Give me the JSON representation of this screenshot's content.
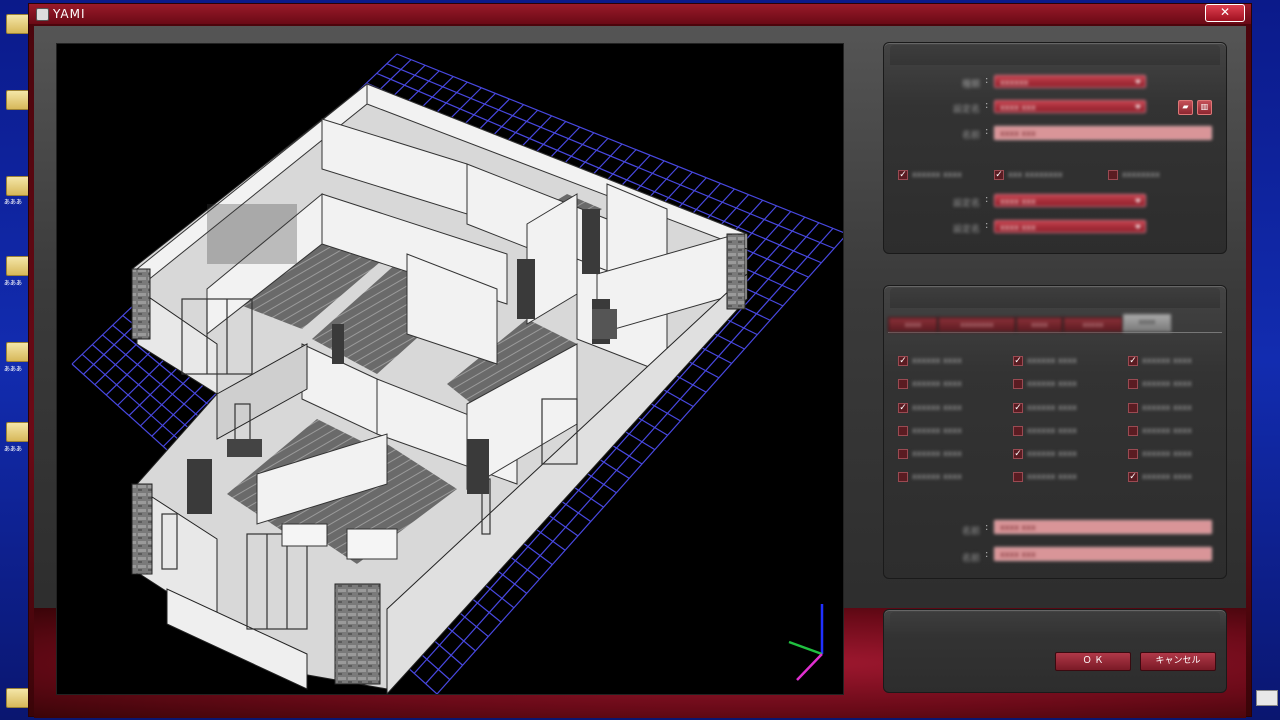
{
  "window": {
    "title": "YAMI",
    "close_label": "✕"
  },
  "desktop": {
    "icon_label": "あああ"
  },
  "panel1": {
    "rows": [
      {
        "label": "種類",
        "value": "xxxxxx"
      },
      {
        "label": "設定名",
        "value": "xxxx xxx"
      }
    ],
    "name_label": "名前",
    "name_value": "xxxx xxx",
    "checks": [
      {
        "label": "xxxxxx xxxx",
        "checked": true
      },
      {
        "label": "xxx xxxxxxxx",
        "checked": true
      },
      {
        "label": "xxxxxxxx",
        "checked": false
      }
    ],
    "rows2": [
      {
        "label": "設定名",
        "value": "xxxx xxx"
      },
      {
        "label": "設定名",
        "value": "xxxx xxx"
      }
    ]
  },
  "panel2": {
    "tabs": [
      "xxxx",
      "xxxxxxxx",
      "xxxx",
      "xxxxx",
      "xxxx"
    ],
    "active_tab": 4,
    "checks": [
      [
        true,
        false,
        true,
        false,
        false,
        false
      ],
      [
        true,
        false,
        true,
        false,
        true,
        false
      ],
      [
        true,
        false,
        false,
        false,
        false,
        true
      ]
    ],
    "check_label": "xxxxxx xxxx",
    "fields": [
      {
        "label": "名前",
        "value": "xxxx xxx"
      },
      {
        "label": "名前",
        "value": "xxxx xxx"
      }
    ]
  },
  "buttons": {
    "ok": "Ｏ Ｋ",
    "cancel": "キャンセル"
  },
  "colors": {
    "accent": "#a01830",
    "grid": "#4a4ae8"
  }
}
